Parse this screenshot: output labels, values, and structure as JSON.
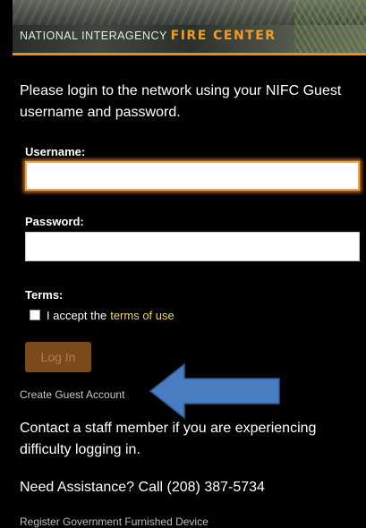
{
  "header": {
    "brand_prefix": "NATIONAL INTERAGENCY ",
    "brand_emphasis": "FIRE CENTER"
  },
  "intro_text": "Please login to the network using your NIFC Guest username and password.",
  "form": {
    "username_label": "Username:",
    "username_value": "",
    "password_label": "Password:",
    "password_value": "",
    "terms_label": "Terms:",
    "accept_prefix": "I accept the",
    "terms_link": "terms of use",
    "login_button": "Log In"
  },
  "links": {
    "create_guest_account": "Create Guest Account",
    "register_device": "Register Government Furnished Device"
  },
  "contact_text": "Contact a staff member if you are experiencing difficulty logging in.",
  "assistance_text": "Need Assistance? Call (208) 387-5734",
  "colors": {
    "accent_orange": "#f08a1c",
    "link_yellow": "#f2d36b",
    "arrow_blue": "#4a7cc1"
  }
}
